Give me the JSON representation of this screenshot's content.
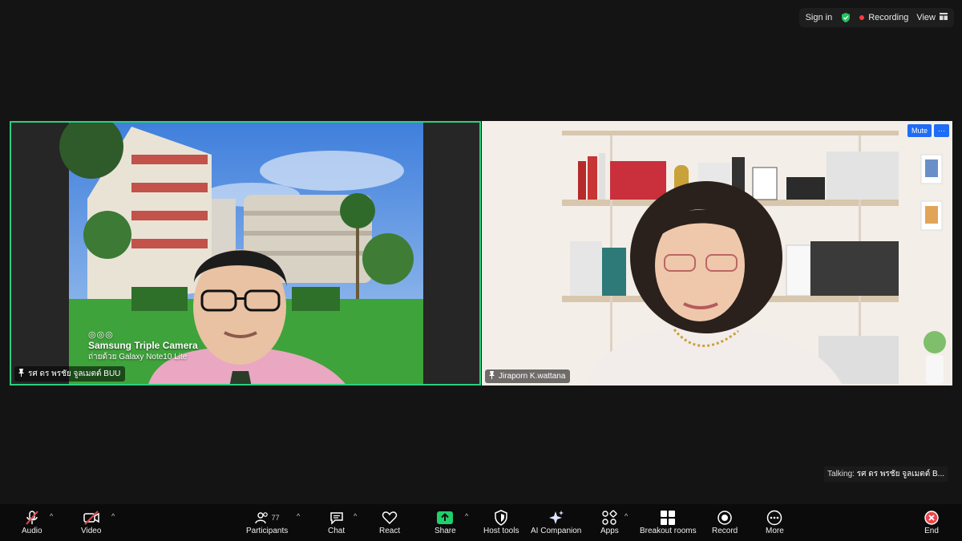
{
  "topbar": {
    "sign_in": "Sign in",
    "recording": "Recording",
    "view": "View"
  },
  "tiles": {
    "left": {
      "name": "รศ ดร พรชัย จูลเมตต์ BUU",
      "watermark_line1": "◎◎◎",
      "watermark_line2": "Samsung Triple Camera",
      "watermark_line3": "ถ่ายด้วย Galaxy Note10 Lite"
    },
    "right": {
      "name": "Jiraporn K.wattana",
      "mute_label": "Mute",
      "more_label": "···"
    }
  },
  "talking": {
    "label": "Talking:",
    "name": "รศ ดร พรชัย จูลเมตต์ B..."
  },
  "toolbar": {
    "audio": "Audio",
    "video": "Video",
    "participants": "Participants",
    "participants_count": "77",
    "chat": "Chat",
    "react": "React",
    "share": "Share",
    "host_tools": "Host tools",
    "ai_companion": "AI Companion",
    "apps": "Apps",
    "breakout_rooms": "Breakout rooms",
    "record": "Record",
    "more": "More",
    "end": "End",
    "caret": "^"
  },
  "colors": {
    "active_speaker_border": "#2bd07b",
    "share_green": "#1fcf6b",
    "end_red": "#e5484d",
    "mute_blue": "#1f6cf5"
  }
}
